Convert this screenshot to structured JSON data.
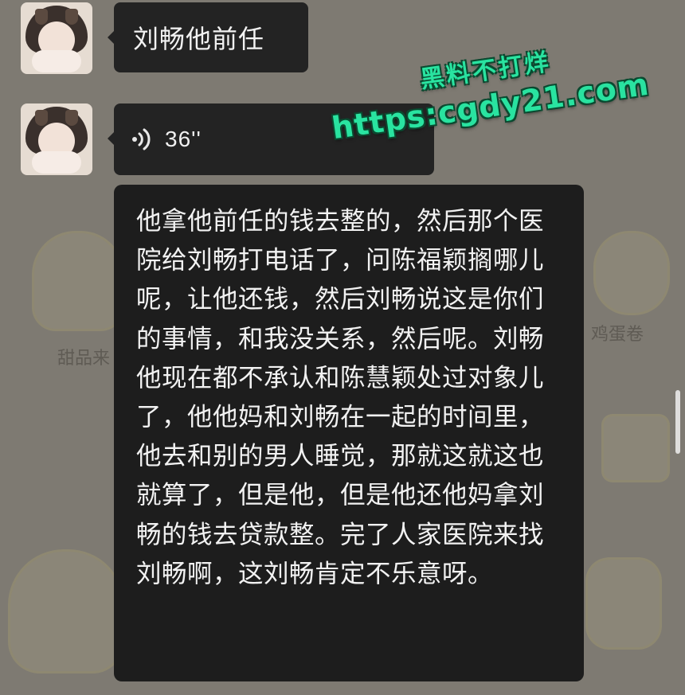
{
  "wallpaper": {
    "texts": [
      "甜品来",
      "鸡蛋卷"
    ]
  },
  "messages": [
    {
      "type": "text",
      "text": "刘畅他前任"
    },
    {
      "type": "voice",
      "duration": "36''",
      "icon": "voice-wave-icon",
      "transcript": "他拿他前任的钱去整的，然后那个医院给刘畅打电话了，问陈福颖搁哪儿呢，让他还钱，然后刘畅说这是你们的事情，和我没关系，然后呢。刘畅他现在都不承认和陈慧颖处过对象儿了，他他妈和刘畅在一起的时间里，他去和别的男人睡觉，那就这就这也就算了，但是他，但是他还他妈拿刘畅的钱去贷款整。完了人家医院来找刘畅啊，这刘畅肯定不乐意呀。"
    }
  ],
  "watermark": {
    "title": "黑料不打烊",
    "url": "https:cgdy21.com",
    "color": "#29e3a0"
  },
  "colors": {
    "bubble": "#232323",
    "transcript_card": "#1d1d1d",
    "text": "#f2f2f2"
  }
}
